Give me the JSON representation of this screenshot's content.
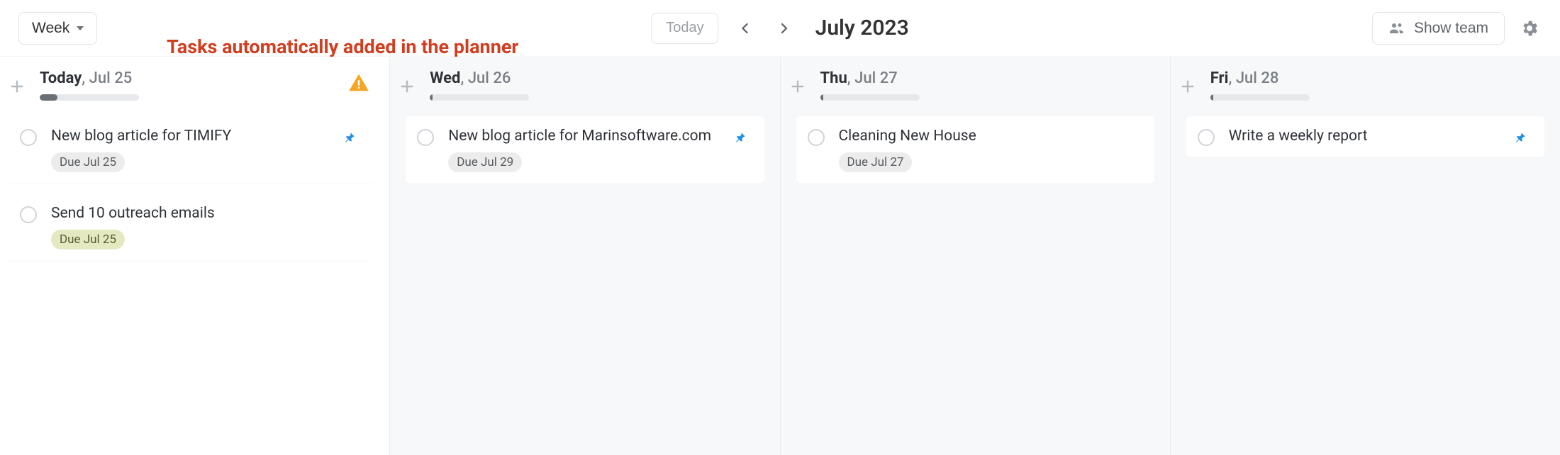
{
  "toolbar": {
    "view_label": "Week",
    "today_label": "Today",
    "month_label": "July 2023",
    "show_team_label": "Show team"
  },
  "annotation": {
    "text": "Tasks automatically added in the planner"
  },
  "columns": [
    {
      "is_today": true,
      "label_bold": "Today",
      "label_rest": ", Jul 25",
      "progress_pct": 18,
      "has_warning": true,
      "tasks": [
        {
          "title": "New blog article for TIMIFY",
          "badge": "Due Jul 25",
          "badge_style": "gray",
          "pinned": true
        },
        {
          "title": "Send 10 outreach emails",
          "badge": "Due Jul 25",
          "badge_style": "olive",
          "pinned": false
        }
      ]
    },
    {
      "is_today": false,
      "label_bold": "Wed",
      "label_rest": ", Jul 26",
      "progress_pct": 3,
      "has_warning": false,
      "tasks": [
        {
          "title": "New blog article for Marinsoftware.com",
          "badge": "Due Jul 29",
          "badge_style": "gray",
          "pinned": true
        }
      ]
    },
    {
      "is_today": false,
      "label_bold": "Thu",
      "label_rest": ", Jul 27",
      "progress_pct": 3,
      "has_warning": false,
      "tasks": [
        {
          "title": "Cleaning New House",
          "badge": "Due Jul 27",
          "badge_style": "gray",
          "pinned": false
        }
      ]
    },
    {
      "is_today": false,
      "label_bold": "Fri",
      "label_rest": ", Jul 28",
      "progress_pct": 3,
      "has_warning": false,
      "tasks": [
        {
          "title": "Write a weekly report",
          "badge": "",
          "badge_style": "",
          "pinned": true
        }
      ]
    }
  ]
}
